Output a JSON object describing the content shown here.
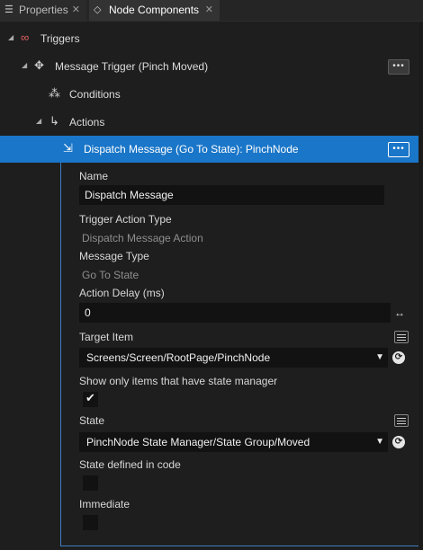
{
  "tabs": [
    {
      "label": "Properties",
      "icon": "properties-icon",
      "close": "✕"
    },
    {
      "label": "Node Components",
      "icon": "node-components-icon",
      "close": "✕"
    }
  ],
  "tree": {
    "triggers": {
      "label": "Triggers",
      "icon": "trigger-icon"
    },
    "message_trigger": {
      "label": "Message Trigger (Pinch Moved)",
      "icon": "message-trigger-icon",
      "more": "•••"
    },
    "conditions": {
      "label": "Conditions",
      "icon": "conditions-icon"
    },
    "actions": {
      "label": "Actions",
      "icon": "actions-icon"
    },
    "dispatch": {
      "label": "Dispatch Message (Go To State): PinchNode",
      "icon": "dispatch-message-icon",
      "more": "•••"
    }
  },
  "properties": {
    "name_label": "Name",
    "name_value": "Dispatch Message",
    "trigger_action_type_label": "Trigger Action Type",
    "trigger_action_type_value": "Dispatch Message Action",
    "message_type_label": "Message Type",
    "message_type_value": "Go To State",
    "action_delay_label": "Action Delay (ms)",
    "action_delay_value": "0",
    "target_item_label": "Target Item",
    "target_item_value": "Screens/Screen/RootPage/PinchNode",
    "show_only_label": "Show only items that have state manager",
    "show_only_checked": true,
    "state_label": "State",
    "state_value": "PinchNode State Manager/State Group/Moved",
    "state_defined_label": "State defined in code",
    "state_defined_checked": false,
    "immediate_label": "Immediate",
    "immediate_checked": false
  },
  "colors": {
    "selection": "#1a76c8",
    "panel_bg": "#1e1e1e",
    "field_bg": "#121212"
  }
}
